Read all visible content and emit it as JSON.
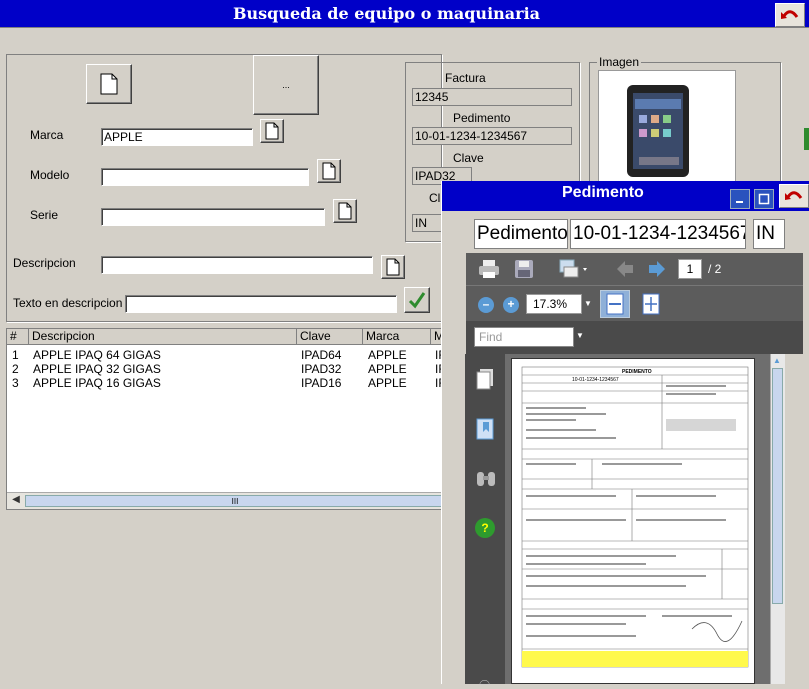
{
  "window": {
    "title": "Busqueda de equipo o maquinaria"
  },
  "form": {
    "marca_label": "Marca",
    "marca_value": "APPLE",
    "modelo_label": "Modelo",
    "modelo_value": "",
    "serie_label": "Serie",
    "serie_value": "",
    "descripcion_label": "Descripcion",
    "descripcion_value": "",
    "texto_label": "Texto en descripcion",
    "texto_value": "",
    "big_button_label": "..."
  },
  "info": {
    "factura_label": "Factura",
    "factura_value": "12345",
    "pedimento_label": "Pedimento",
    "pedimento_value": "10-01-1234-1234567",
    "clave_label": "Clave",
    "clave_value": "IPAD32",
    "cl_label": "Cl",
    "cl_value": "IN"
  },
  "imagen": {
    "label": "Imagen"
  },
  "grid": {
    "headers": [
      "#",
      "Descripcion",
      "Clave",
      "Marca",
      "M"
    ],
    "rows": [
      [
        "1",
        "APPLE IPAQ 64 GIGAS",
        "IPAD64",
        "APPLE",
        "IF"
      ],
      [
        "2",
        "APPLE IPAQ 32 GIGAS",
        "IPAD32",
        "APPLE",
        "IF"
      ],
      [
        "3",
        "APPLE IPAQ 16 GIGAS",
        "IPAD16",
        "APPLE",
        "IF"
      ]
    ],
    "scroll_grip": "III"
  },
  "pedimento_window": {
    "title": "Pedimento",
    "label": "Pedimento",
    "number": "10-01-1234-1234567",
    "code": "IN"
  },
  "pdf": {
    "page_current": "1",
    "page_total": "/ 2",
    "zoom": "17.3%",
    "find_placeholder": "Find",
    "doc_header": "PEDIMENTO",
    "doc_number": "10-01-1234-1234567"
  },
  "colors": {
    "titlebar": "#0000c8",
    "face": "#d4d0c8",
    "pdf_toolbar": "#5c5c5c",
    "accent_green": "#2e8b2e"
  }
}
